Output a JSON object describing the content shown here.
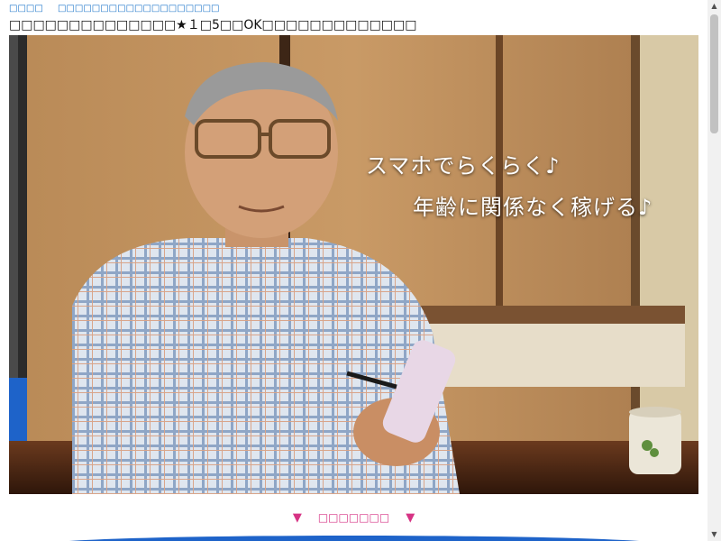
{
  "breadcrumb": {
    "items": [
      {
        "label": "□□□□"
      },
      {
        "label": "□□□□□□□□□□□□□□□□□□□"
      }
    ]
  },
  "page": {
    "title": "□□□□□□□□□□□□□□★１□5□□OK□□□□□□□□□□□□□"
  },
  "hero": {
    "caption_line_1": "スマホでらくらく♪",
    "caption_line_2": "年齢に関係なく稼げる♪"
  },
  "section": {
    "arrow": "▼",
    "label": "□□□□□□□"
  },
  "colors": {
    "link": "#1a73c8",
    "accent_pink": "#d63384",
    "brand_blue": "#1e63c9"
  },
  "icons": {
    "scroll_up": "▲",
    "scroll_down": "▼"
  }
}
